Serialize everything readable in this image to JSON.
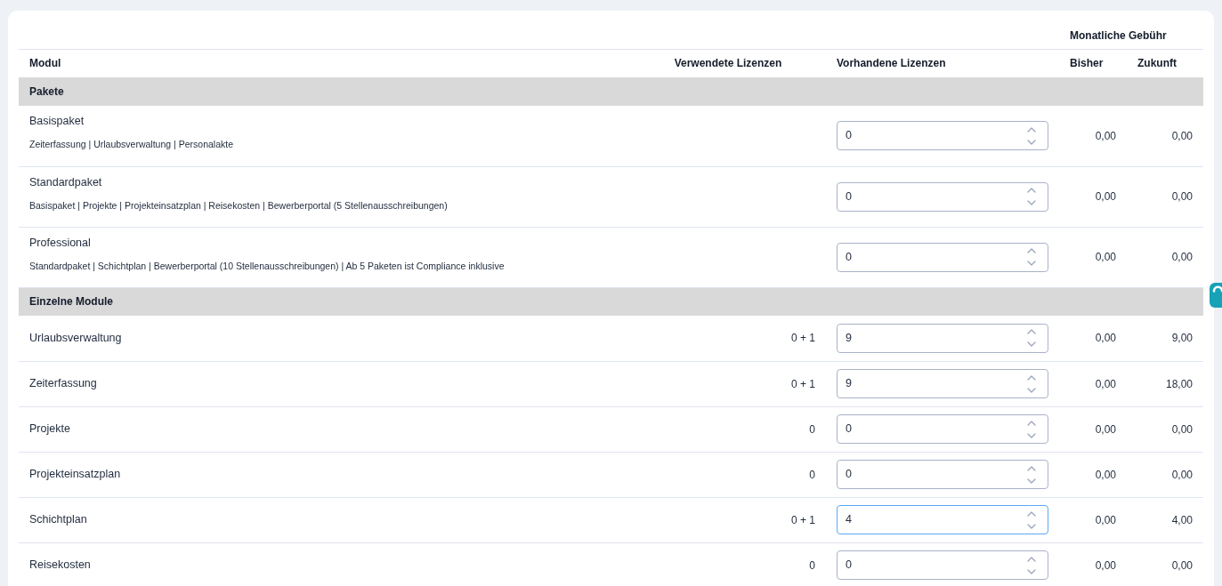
{
  "table": {
    "group_heading": "Monatliche Gebühr",
    "columns": [
      "Modul",
      "Verwendete Lizenzen",
      "Vorhandene Lizenzen",
      "Bisher",
      "Zukunft"
    ],
    "sections": [
      {
        "title": "Pakete",
        "rows": [
          {
            "name": "Basispaket",
            "description": "Zeiterfassung | Urlaubsverwaltung | Personalakte",
            "available": "0",
            "focused": false,
            "fee_current": "0,00",
            "fee_future": "0,00"
          },
          {
            "name": "Standardpaket",
            "description": "Basispaket | Projekte | Projekteinsatzplan | Reisekosten | Bewerberportal (5 Stellenausschreibungen)",
            "available": "0",
            "focused": false,
            "fee_current": "0,00",
            "fee_future": "0,00"
          },
          {
            "name": "Professional",
            "description": "Standardpaket | Schichtplan | Bewerberportal (10 Stellenausschreibungen) | Ab 5 Paketen ist Compliance inklusive",
            "available": "0",
            "focused": false,
            "fee_current": "0,00",
            "fee_future": "0,00"
          }
        ]
      },
      {
        "title": "Einzelne Module",
        "rows": [
          {
            "name": "Urlaubsverwaltung",
            "used": "0 + 1",
            "available": "9",
            "focused": false,
            "fee_current": "0,00",
            "fee_future": "9,00"
          },
          {
            "name": "Zeiterfassung",
            "used": "0 + 1",
            "available": "9",
            "focused": false,
            "fee_current": "0,00",
            "fee_future": "18,00"
          },
          {
            "name": "Projekte",
            "used": "0",
            "available": "0",
            "focused": false,
            "fee_current": "0,00",
            "fee_future": "0,00"
          },
          {
            "name": "Projekteinsatzplan",
            "used": "0",
            "available": "0",
            "focused": false,
            "fee_current": "0,00",
            "fee_future": "0,00"
          },
          {
            "name": "Schichtplan",
            "used": "0 + 1",
            "available": "4",
            "focused": true,
            "fee_current": "0,00",
            "fee_future": "4,00"
          },
          {
            "name": "Reisekosten",
            "used": "0",
            "available": "0",
            "focused": false,
            "fee_current": "0,00",
            "fee_future": "0,00"
          }
        ]
      }
    ]
  }
}
